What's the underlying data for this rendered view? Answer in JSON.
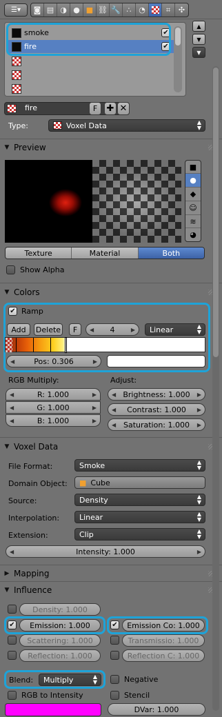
{
  "slots": {
    "items": [
      {
        "label": "smoke",
        "selected": false,
        "enabled": true
      },
      {
        "label": "fire",
        "selected": true,
        "enabled": true
      },
      {
        "label": "",
        "selected": false
      },
      {
        "label": "",
        "selected": false
      },
      {
        "label": "",
        "selected": false
      }
    ]
  },
  "texture": {
    "name": "fire",
    "fake_user": "F",
    "type_label": "Type:",
    "type_value": "Voxel Data"
  },
  "preview": {
    "header": "Preview",
    "tabs": [
      "Texture",
      "Material",
      "Both"
    ],
    "active_tab": "Both",
    "show_alpha": "Show Alpha"
  },
  "colors": {
    "header": "Colors",
    "ramp": "Ramp",
    "add": "Add",
    "delete": "Delete",
    "flip": "F",
    "active_stop": "4",
    "interpolation": "Linear",
    "pos": "Pos: 0.306",
    "rgb_multiply": "RGB Multiply:",
    "r": "R: 1.000",
    "g": "G: 1.000",
    "b": "B: 1.000",
    "adjust": "Adjust:",
    "brightness": "Brightness: 1.000",
    "contrast": "Contrast: 1.000",
    "saturation": "Saturation: 1.000"
  },
  "voxel": {
    "header": "Voxel Data",
    "file_format_label": "File Format:",
    "file_format": "Smoke",
    "domain_label": "Domain Object:",
    "domain": "Cube",
    "source_label": "Source:",
    "source": "Density",
    "interp_label": "Interpolation:",
    "interp": "Linear",
    "ext_label": "Extension:",
    "ext": "Clip",
    "intensity": "Intensity: 1.000"
  },
  "mapping": {
    "header": "Mapping"
  },
  "influence": {
    "header": "Influence",
    "density": "Density: 1.000",
    "emission": "Emission: 1.000",
    "scattering": "Scattering: 1.000",
    "reflection": "Reflection: 1.000",
    "emission_col": "Emission Co: 1.000",
    "transmission": "Transmissio: 1.000",
    "reflection_col": "Reflection C: 1.000",
    "blend_label": "Blend:",
    "blend": "Multiply",
    "negative": "Negative",
    "rgb_to_intensity": "RGB to Intensity",
    "stencil": "Stencil",
    "dvar": "DVar: 1.000",
    "color": "#ff00ff"
  },
  "colors_theme": {
    "highlight": "#1ea3d8",
    "selected": "#5680c2"
  }
}
